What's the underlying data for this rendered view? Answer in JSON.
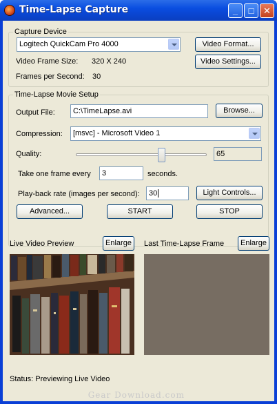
{
  "window": {
    "title": "Time-Lapse Capture",
    "min_glyph": "_",
    "max_glyph": "□",
    "close_glyph": "✕"
  },
  "capture_device": {
    "group_label": "Capture Device",
    "device_selected": "Logitech QuickCam Pro 4000",
    "video_format_button": "Video Format...",
    "video_settings_button": "Video Settings...",
    "frame_size_label": "Video Frame Size:",
    "frame_size_value": "320 X 240",
    "fps_label": "Frames per Second:",
    "fps_value": "30"
  },
  "movie_setup": {
    "group_label": "Time-Lapse Movie Setup",
    "output_file_label": "Output File:",
    "output_file_value": "C:\\TimeLapse.avi",
    "browse_button": "Browse...",
    "compression_label": "Compression:",
    "compression_selected": "[msvc] - Microsoft Video 1",
    "quality_label": "Quality:",
    "quality_value": "65",
    "quality_fraction": 0.65,
    "take_frame_label": "Take one frame every",
    "take_frame_value": "3",
    "seconds_label": "seconds.",
    "playback_label": "Play-back rate (images per second):",
    "playback_value": "30",
    "light_controls_button": "Light Controls...",
    "advanced_button": "Advanced...",
    "start_button": "START",
    "stop_button": "STOP"
  },
  "previews": {
    "live_label": "Live Video Preview",
    "live_enlarge": "Enlarge",
    "last_label": "Last Time-Lapse Frame",
    "last_enlarge": "Enlarge"
  },
  "status": {
    "text": "Status:  Previewing Live Video"
  },
  "watermark": "Gear Download.com",
  "colors": {
    "titlebar": "#0a4ee0",
    "dialog_bg": "#ece9d8",
    "last_frame_bg": "#776d62"
  }
}
